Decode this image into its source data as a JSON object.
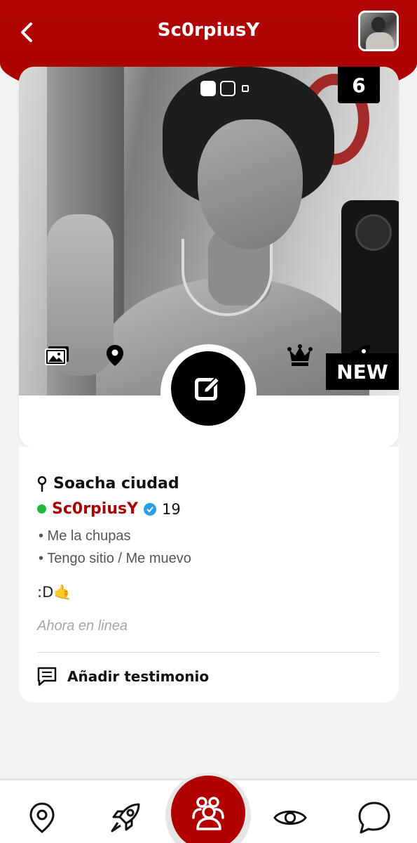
{
  "header": {
    "title": "Sc0rpiusY",
    "back_icon": "chevron-left-icon",
    "avatar": "profile-thumbnail",
    "accent_color": "#b00000"
  },
  "photo": {
    "count_badge": "6",
    "new_badge": "NEW",
    "slide_indicators": 3
  },
  "card_actions": {
    "icons": [
      "gallery-icon",
      "location-pin-icon",
      "edit-icon",
      "crown-icon",
      "rocket-icon"
    ]
  },
  "profile": {
    "location": "Soacha ciudad",
    "name": "Sc0rpiusY",
    "age": "19",
    "online_color": "#1fb83d",
    "tags": [
      "• Me la chupas",
      "• Tengo sitio / Me muevo"
    ],
    "bio": ":D🤙",
    "status": "Ahora en linea",
    "testimonial_label": "Añadir testimonio"
  },
  "bottom_nav": {
    "items": [
      "map-pin-icon",
      "rocket-icon",
      "users-icon",
      "eye-icon",
      "chat-bubble-icon"
    ]
  }
}
